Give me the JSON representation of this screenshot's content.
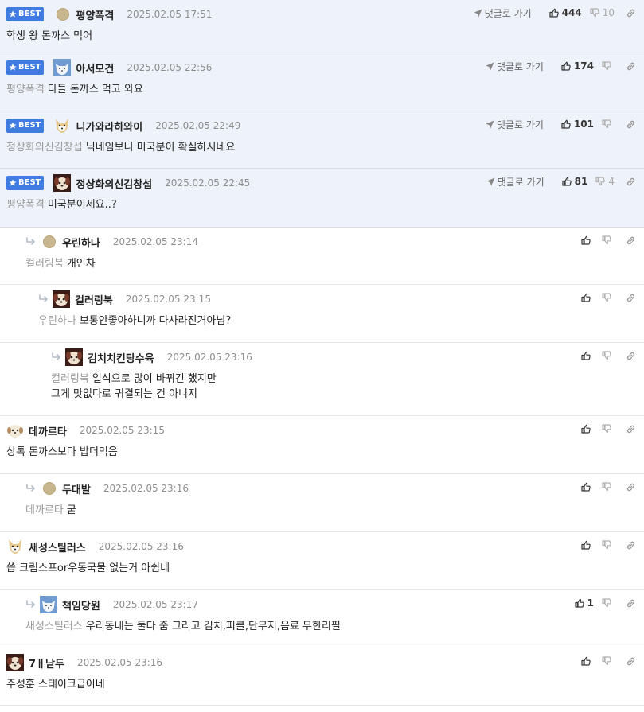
{
  "ui": {
    "best_label": "BEST",
    "goto_label": "댓글로 가기"
  },
  "comments": [
    {
      "best": true,
      "depth": 0,
      "avatar": "dot",
      "nick": "평양폭격",
      "time": "2025.02.05 17:51",
      "mention": "",
      "lines": [
        "학생 왕 돈까스 먹어"
      ],
      "up": "444",
      "down": "10",
      "goto": true
    },
    {
      "best": true,
      "depth": 0,
      "avatar": "white-fox",
      "nick": "아서모건",
      "time": "2025.02.05 22:56",
      "mention": "평양폭격",
      "lines": [
        "다들 돈까스 먹고 와요"
      ],
      "up": "174",
      "down": "",
      "goto": true
    },
    {
      "best": true,
      "depth": 0,
      "avatar": "fox",
      "nick": "니가와라하와이",
      "time": "2025.02.05 22:49",
      "mention": "정상화의신김창섭",
      "lines": [
        "닉네임보니 미국분이 확실하시네요"
      ],
      "up": "101",
      "down": "",
      "goto": true
    },
    {
      "best": true,
      "depth": 0,
      "avatar": "dog",
      "nick": "정상화의신김창섭",
      "time": "2025.02.05 22:45",
      "mention": "평양폭격",
      "lines": [
        "미국분이세요..?"
      ],
      "up": "81",
      "down": "4",
      "goto": true
    },
    {
      "best": false,
      "depth": 1,
      "avatar": "dot",
      "nick": "우린하나",
      "time": "2025.02.05 23:14",
      "mention": "컬러링북",
      "lines": [
        "개인차"
      ],
      "up": "",
      "down": "",
      "goto": false
    },
    {
      "best": false,
      "depth": 2,
      "avatar": "dog",
      "nick": "컬러링북",
      "time": "2025.02.05 23:15",
      "mention": "우린하나",
      "lines": [
        "보통안좋아하니까 다사라진거아님?"
      ],
      "up": "",
      "down": "",
      "goto": false
    },
    {
      "best": false,
      "depth": 3,
      "avatar": "dog",
      "nick": "김치치킨탕수육",
      "time": "2025.02.05 23:16",
      "mention": "컬러링북",
      "lines": [
        "일식으로 많이 바뀌긴 했지만",
        "그게 맛없다로 귀결되는 건 아니지"
      ],
      "up": "",
      "down": "",
      "goto": false
    },
    {
      "best": false,
      "depth": 0,
      "avatar": "pup",
      "nick": "데까르타",
      "time": "2025.02.05 23:15",
      "mention": "",
      "lines": [
        "상톡 돈까스보다 밥더먹음"
      ],
      "up": "",
      "down": "",
      "goto": false
    },
    {
      "best": false,
      "depth": 1,
      "avatar": "dot",
      "nick": "두대발",
      "time": "2025.02.05 23:16",
      "mention": "데까르타",
      "lines": [
        "굳"
      ],
      "up": "",
      "down": "",
      "goto": false
    },
    {
      "best": false,
      "depth": 0,
      "avatar": "fox",
      "nick": "새성스틸러스",
      "time": "2025.02.05 23:16",
      "mention": "",
      "lines": [
        "씁 크림스프or우동국물 없는거 아쉽네"
      ],
      "up": "",
      "down": "",
      "goto": false
    },
    {
      "best": false,
      "depth": 1,
      "avatar": "white-fox",
      "nick": "책임당원",
      "time": "2025.02.05 23:17",
      "mention": "새성스틸러스",
      "lines": [
        "우리동네는 둘다 줌 그리고 김치,피클,단무지,음료 무한리필"
      ],
      "up": "1",
      "down": "",
      "goto": false
    },
    {
      "best": false,
      "depth": 0,
      "avatar": "dog",
      "nick": "7ㅐ낟두",
      "time": "2025.02.05 23:16",
      "mention": "",
      "lines": [
        "주성훈 스테이크급이네"
      ],
      "up": "",
      "down": "",
      "goto": false
    }
  ]
}
